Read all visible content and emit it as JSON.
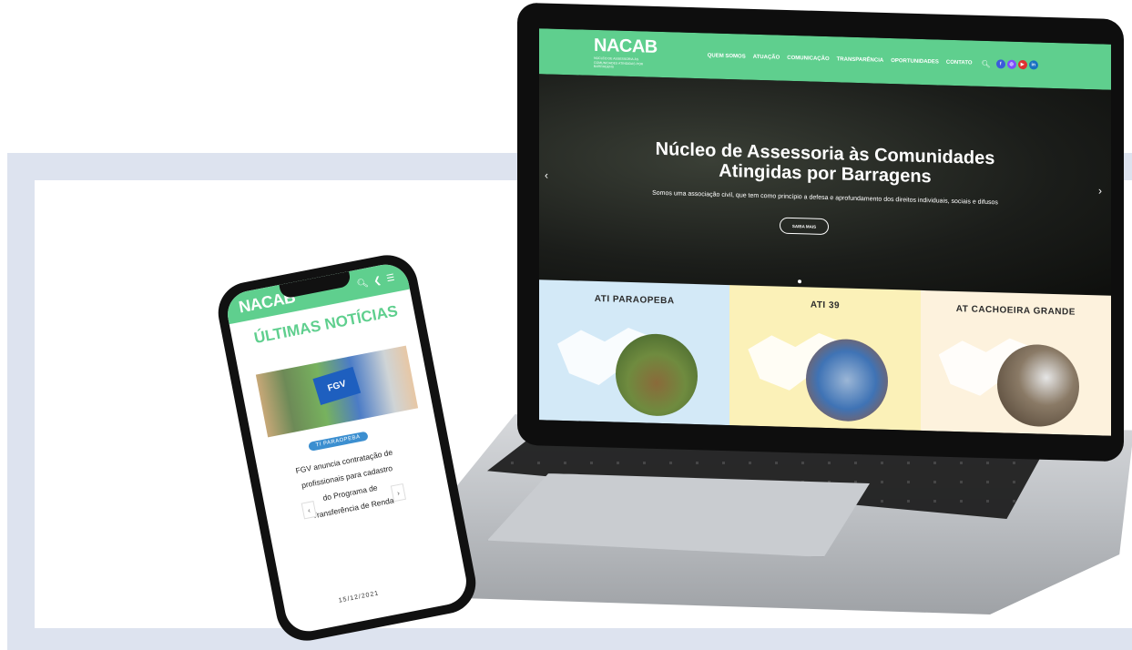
{
  "site": {
    "logo": "NACAB",
    "logo_subtitle": "NÚCLEO DE ASSESSORIA ÀS COMUNIDADES ATINGIDAS POR BARRAGENS",
    "nav": [
      "QUEM SOMOS",
      "ATUAÇÃO",
      "COMUNICAÇÃO",
      "TRANSPARÊNCIA",
      "OPORTUNIDADES",
      "CONTATO"
    ],
    "search_icon": "search-icon",
    "social": [
      {
        "icon": "facebook-icon",
        "glyph": "f",
        "color": "#3b5bdb"
      },
      {
        "icon": "instagram-icon",
        "glyph": "◎",
        "color": "#7c4dff"
      },
      {
        "icon": "youtube-icon",
        "glyph": "▶",
        "color": "#e03131"
      },
      {
        "icon": "linkedin-icon",
        "glyph": "in",
        "color": "#1971c2"
      }
    ]
  },
  "hero": {
    "title": "Núcleo de Assessoria às Comunidades Atingidas por Barragens",
    "subtitle": "Somos uma associação civil, que tem como princípio a defesa e aprofundamento dos direitos individuais, sociais e difusos",
    "button": "SAIBA MAIS"
  },
  "panels": [
    {
      "title": "ATI PARAOPEBA",
      "bg": "#d3e9f7",
      "photo": "#6f8b3f"
    },
    {
      "title": "ATI 39",
      "bg": "#fbf1b8",
      "photo": "#3f73b5"
    },
    {
      "title": "AT CACHOEIRA GRANDE",
      "bg": "#fdf2dd",
      "photo": "#6b5a46"
    }
  ],
  "phone": {
    "logo": "NACAB",
    "heading": "ÚLTIMAS NOTÍCIAS",
    "image_sign": "FGV",
    "tag": "TI PARAOPEBA",
    "headline": "FGV anuncia contratação de profissionais para cadastro do Programa de Transferência de Renda",
    "date": "15/12/2021",
    "prev": "‹",
    "next": "›"
  },
  "colors": {
    "brand_green": "#5fcf8e",
    "frame": "#dde3ef"
  }
}
